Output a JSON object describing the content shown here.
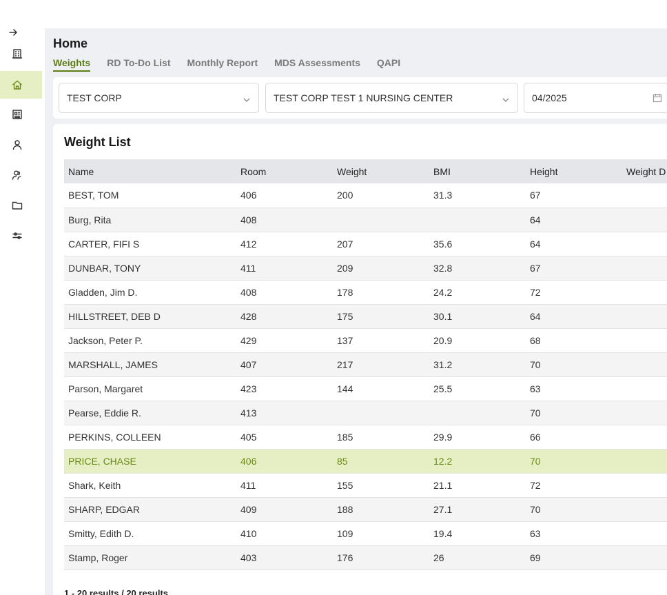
{
  "sidebar": {
    "items": [
      {
        "name": "building-icon"
      },
      {
        "name": "home-icon",
        "active": true
      },
      {
        "name": "report-icon"
      },
      {
        "name": "user-icon"
      },
      {
        "name": "users-icon"
      },
      {
        "name": "folder-icon"
      },
      {
        "name": "sliders-icon"
      }
    ]
  },
  "header": {
    "title": "Home",
    "tabs": [
      {
        "label": "Weights",
        "active": true
      },
      {
        "label": "RD To-Do List"
      },
      {
        "label": "Monthly Report"
      },
      {
        "label": "MDS Assessments"
      },
      {
        "label": "QAPI"
      }
    ]
  },
  "filters": {
    "corp": "TEST CORP",
    "facility": "TEST CORP TEST 1 NURSING CENTER",
    "date": "04/2025"
  },
  "weight_list": {
    "title": "Weight List",
    "columns": [
      "Name",
      "Room",
      "Weight",
      "BMI",
      "Height",
      "Weight D"
    ],
    "rows": [
      [
        "BEST, TOM",
        "406",
        "200",
        "31.3",
        "67"
      ],
      [
        "Burg, Rita",
        "408",
        "",
        "",
        "64"
      ],
      [
        "CARTER, FIFI S",
        "412",
        "207",
        "35.6",
        "64"
      ],
      [
        "DUNBAR, TONY",
        "411",
        "209",
        "32.8",
        "67"
      ],
      [
        "Gladden, Jim D.",
        "408",
        "178",
        "24.2",
        "72"
      ],
      [
        "HILLSTREET, DEB D",
        "428",
        "175",
        "30.1",
        "64"
      ],
      [
        "Jackson, Peter P.",
        "429",
        "137",
        "20.9",
        "68"
      ],
      [
        "MARSHALL, JAMES",
        "407",
        "217",
        "31.2",
        "70"
      ],
      [
        "Parson, Margaret",
        "423",
        "144",
        "25.5",
        "63"
      ],
      [
        "Pearse, Eddie R.",
        "413",
        "",
        "",
        "70"
      ],
      [
        "PERKINS, COLLEEN",
        "405",
        "185",
        "29.9",
        "66"
      ],
      [
        "PRICE, CHASE",
        "406",
        "85",
        "12.2",
        "70"
      ],
      [
        "Shark, Keith",
        "411",
        "155",
        "21.1",
        "72"
      ],
      [
        "SHARP, EDGAR",
        "409",
        "188",
        "27.1",
        "70"
      ],
      [
        "Smitty, Edith D.",
        "410",
        "109",
        "19.4",
        "63"
      ],
      [
        "Stamp, Roger",
        "403",
        "176",
        "26",
        "69"
      ]
    ],
    "highlighted_row": "PRICE, CHASE",
    "results_text": "1 - 20 results / 20 results"
  },
  "colors": {
    "accent": "#5b7d12",
    "highlight_bg": "#e6efc4",
    "panel_bg": "#eef0f3"
  }
}
